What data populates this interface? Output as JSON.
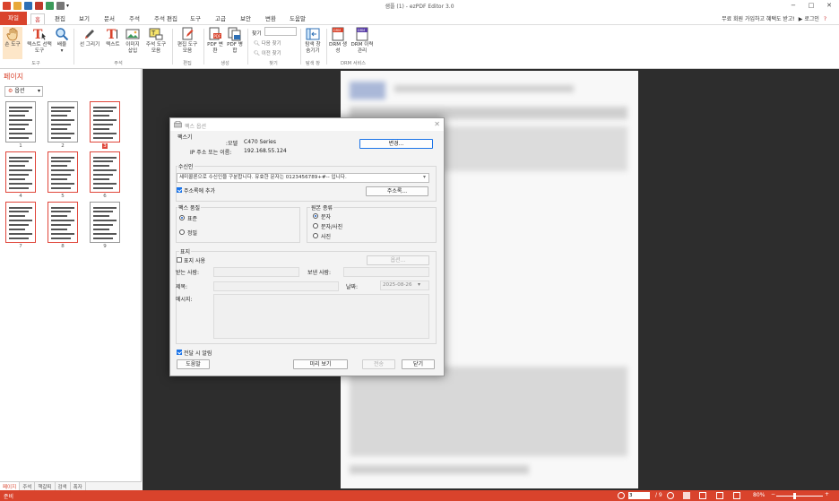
{
  "window": {
    "title": "샘플 (1) - ezPDF Editor 3.0",
    "minimize": "−",
    "maximize": "□",
    "close": "✕"
  },
  "menu": {
    "file": "파일",
    "tabs": [
      "홈",
      "편집",
      "보기",
      "문서",
      "주석",
      "주석 편집",
      "도구",
      "고급",
      "보안",
      "변환",
      "도움말"
    ],
    "promo": "무료 회원 가입하고 혜택도 받고!",
    "login": "로그인"
  },
  "ribbon": {
    "buttons": {
      "hand": "손 도구",
      "select_text": "텍스트 선택 도구",
      "zoom": "배율",
      "draw": "선 그리기",
      "text": "텍스트",
      "image_insert": "이미지 삽입",
      "annot_tools": "주석 도구 모음",
      "edit_tools": "편집 도구 모음",
      "pdf_convert": "PDF 변환",
      "pdf_merge": "PDF 병합",
      "find_label": "찾기",
      "find_next": "다음 찾기",
      "find_prev": "이전 찾기",
      "explorer": "탐색 창 숨기기",
      "drm_create": "DRM 생성",
      "drm_manage": "DRM 이력 관리"
    },
    "groups": [
      "도구",
      "주석",
      "편집",
      "생성",
      "찾기",
      "탐색 창",
      "DRM 서비스"
    ]
  },
  "left_panel": {
    "title": "페이지",
    "options_label": "옵션",
    "thumbnails": [
      {
        "num": "1",
        "selected": false
      },
      {
        "num": "2",
        "selected": false
      },
      {
        "num": "3",
        "selected": true
      },
      {
        "num": "4",
        "selected": true
      },
      {
        "num": "5",
        "selected": true
      },
      {
        "num": "6",
        "selected": true
      },
      {
        "num": "7",
        "selected": true
      },
      {
        "num": "8",
        "selected": true
      },
      {
        "num": "9",
        "selected": false
      }
    ],
    "tabs": [
      "페이지",
      "주석",
      "책갈피",
      "검색",
      "폭자"
    ]
  },
  "status": {
    "text": "준비",
    "page_current": "3",
    "page_total": "/ 9",
    "zoom": "80%"
  },
  "dialog": {
    "title": "팩스 옵션",
    "fax_section": "팩스기",
    "model_label": "모델:",
    "model_value": "C470 Series",
    "ip_label": "IP 주소 또는 이름:",
    "ip_value": "192.168.55.124",
    "change_button": "변경...",
    "recipient_section": "수신인",
    "recipient_value": "세미콜론으로 수신인을 구분합니다. 유효한 문자는 0123456789+#-- 입니다.",
    "add_to_addressbook": "주소록에 추가",
    "addressbook_button": "주소록...",
    "quality_section": "팩스 품질",
    "quality_standard": "표준",
    "quality_fine": "정밀",
    "source_section": "원본 종류",
    "source_text": "문자",
    "source_text_photo": "문자/사진",
    "source_photo": "사진",
    "cover_section": "표지",
    "use_cover": "표지 사용",
    "cover_options_button": "옵션...",
    "to_label": "받는 사람:",
    "from_label": "보낸 사람:",
    "subject_label": "제목:",
    "date_label": "날짜:",
    "date_value": "2025-08-26",
    "message_label": "메시지:",
    "notify_label": "전달 시 알림",
    "help_button": "도움말",
    "preview_button": "미리 보기",
    "send_button": "전송",
    "close_button": "닫기"
  }
}
